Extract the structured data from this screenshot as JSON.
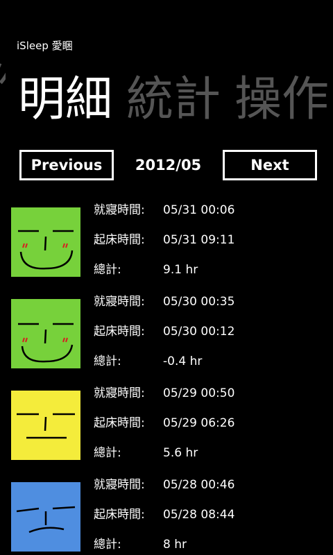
{
  "app": {
    "title": "iSleep 愛睏"
  },
  "pivot": {
    "peek_label": "作",
    "items": [
      "明細",
      "統計",
      "操作"
    ]
  },
  "nav": {
    "previous_label": "Previous",
    "next_label": "Next",
    "current_month": "2012/05"
  },
  "labels": {
    "bedtime": "就寢時間:",
    "wakeup": "起床時間:",
    "total": "總計:"
  },
  "entries": [
    {
      "bedtime": "05/31 00:06",
      "wakeup": "05/31 09:11",
      "total": "9.1 hr",
      "mood": "happy",
      "color": "#77d13b"
    },
    {
      "bedtime": "05/30 00:35",
      "wakeup": "05/30 00:12",
      "total": "-0.4 hr",
      "mood": "happy",
      "color": "#77d13b"
    },
    {
      "bedtime": "05/29 00:50",
      "wakeup": "05/29 06:26",
      "total": "5.6 hr",
      "mood": "neutral",
      "color": "#f4ec3b"
    },
    {
      "bedtime": "05/28 00:46",
      "wakeup": "05/28 08:44",
      "total": "8 hr",
      "mood": "sad",
      "color": "#4f8ee0"
    }
  ]
}
